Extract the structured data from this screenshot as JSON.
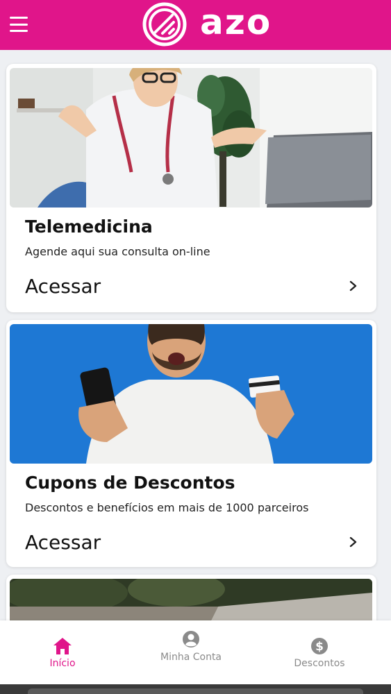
{
  "header": {
    "brand": "azo",
    "menu_icon": "hamburger-menu-icon",
    "logo_icon": "azo-logo-icon",
    "color": "#e0158a"
  },
  "cards": [
    {
      "title": "Telemedicina",
      "subtitle": "Agende aqui sua consulta on-line",
      "action": "Acessar",
      "image": "doctor-video-call-photo"
    },
    {
      "title": "Cupons de Descontos",
      "subtitle": "Descontos e benefícios em mais de 1000 parceiros",
      "action": "Acessar",
      "image": "man-with-phone-and-card-photo"
    }
  ],
  "bottom_nav": {
    "items": [
      {
        "label": "Início",
        "icon": "home-icon",
        "active": true
      },
      {
        "label": "Minha Conta",
        "icon": "account-icon",
        "active": false
      },
      {
        "label": "Descontos",
        "icon": "dollar-icon",
        "active": false
      }
    ],
    "active_color": "#e0158a",
    "inactive_color": "#8a8a8a"
  }
}
